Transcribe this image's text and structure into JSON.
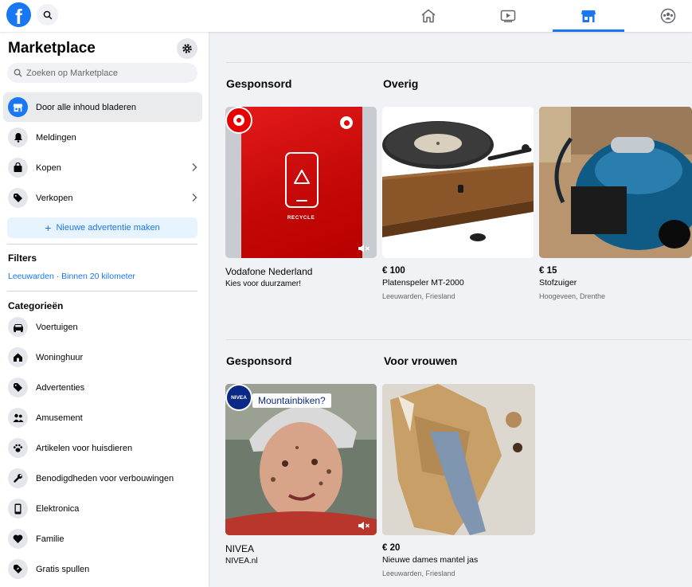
{
  "topbar": {
    "logo_letter": "f",
    "nav": [
      {
        "name": "home"
      },
      {
        "name": "watch"
      },
      {
        "name": "marketplace",
        "active": true
      },
      {
        "name": "groups"
      }
    ]
  },
  "sidebar": {
    "title": "Marketplace",
    "search_placeholder": "Zoeken op Marketplace",
    "items": [
      {
        "label": "Door alle inhoud bladeren",
        "icon": "marketplace-store-icon",
        "active": true
      },
      {
        "label": "Meldingen",
        "icon": "bell-icon"
      },
      {
        "label": "Kopen",
        "icon": "shopping-bag-icon"
      },
      {
        "label": "Verkopen",
        "icon": "price-tag-icon"
      }
    ],
    "new_ad_button": "Nieuwe advertentie maken",
    "filters_heading": "Filters",
    "location_filter": "Leeuwarden · Binnen 20 kilometer",
    "categories_heading": "Categorieën",
    "categories": [
      {
        "label": "Voertuigen",
        "icon": "car-icon"
      },
      {
        "label": "Woninghuur",
        "icon": "house-icon"
      },
      {
        "label": "Advertenties",
        "icon": "tag-icon"
      },
      {
        "label": "Amusement",
        "icon": "people-icon"
      },
      {
        "label": "Artikelen voor huisdieren",
        "icon": "paw-icon"
      },
      {
        "label": "Benodigdheden voor verbouwingen",
        "icon": "wrench-icon"
      },
      {
        "label": "Elektronica",
        "icon": "phone-icon"
      },
      {
        "label": "Familie",
        "icon": "heart-icon"
      },
      {
        "label": "Gratis spullen",
        "icon": "gift-tag-icon"
      }
    ]
  },
  "main": {
    "row1": {
      "sponsored_heading": "Gesponsord",
      "section_heading": "Overig",
      "ad": {
        "name": "Vodafone Nederland",
        "sub": "Kies voor duurzamer!",
        "image_text": "RECYCLE",
        "brand_color": "#e60000"
      },
      "listings": [
        {
          "price": "€ 100",
          "title": "Platenspeler MT-2000",
          "location": "Leeuwarden, Friesland"
        },
        {
          "price": "€ 15",
          "title": "Stofzuiger",
          "location": "Hoogeveen, Drenthe"
        }
      ]
    },
    "row2": {
      "sponsored_heading": "Gesponsord",
      "section_heading": "Voor vrouwen",
      "ad": {
        "name": "NIVEA",
        "sub": "NIVEA.nl",
        "badge_text": "NIVEA",
        "bubble_text": "Mountainbiken?",
        "brand_color": "#0b2a87"
      },
      "listings": [
        {
          "price": "€ 20",
          "title": "Nieuwe dames mantel jas",
          "location": "Leeuwarden, Friesland"
        }
      ]
    }
  },
  "colors": {
    "accent": "#1877f2",
    "background": "#f0f2f5"
  }
}
